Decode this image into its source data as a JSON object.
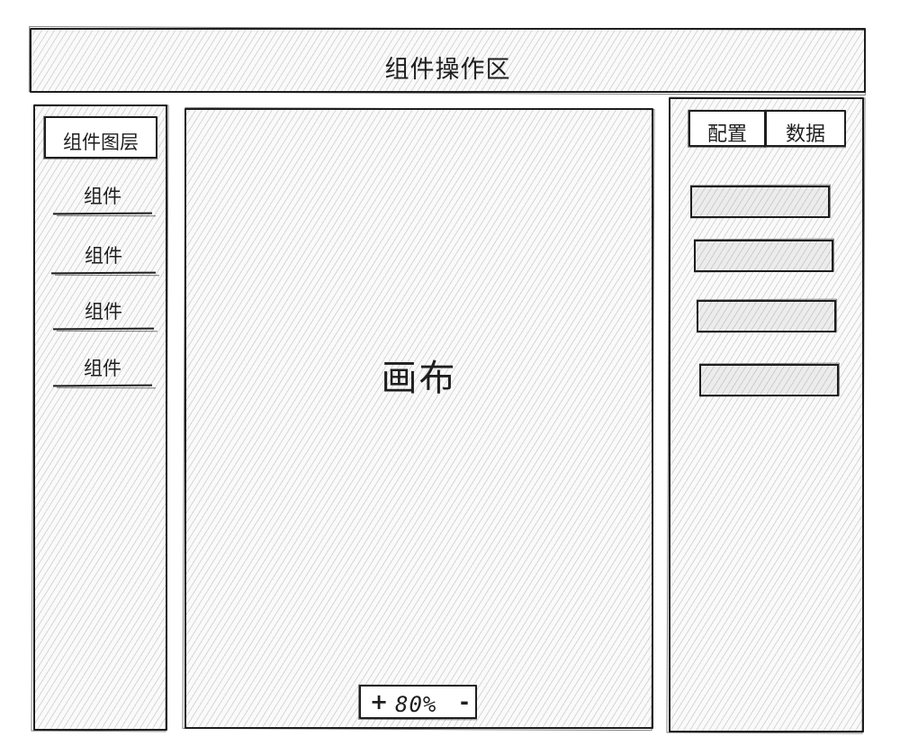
{
  "header": {
    "title": "组件操作区"
  },
  "left_panel": {
    "tab_label": "组件图层",
    "items": [
      {
        "label": "组件"
      },
      {
        "label": "组件"
      },
      {
        "label": "组件"
      },
      {
        "label": "组件"
      }
    ]
  },
  "canvas": {
    "title": "画布",
    "zoom": {
      "plus": "+",
      "level": "80%",
      "minus": "-"
    }
  },
  "right_panel": {
    "tabs": [
      {
        "label": "配置"
      },
      {
        "label": "数据"
      }
    ],
    "fields": [
      {
        "value": ""
      },
      {
        "value": ""
      },
      {
        "value": ""
      },
      {
        "value": ""
      }
    ]
  }
}
